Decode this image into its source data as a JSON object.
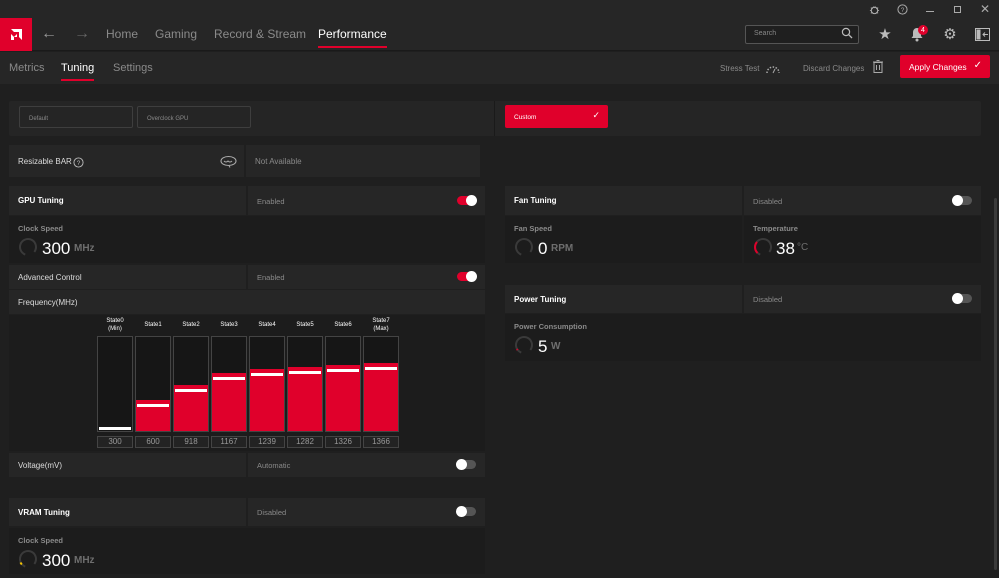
{
  "titlebar": {
    "icons": [
      "bug-icon",
      "help-icon",
      "minimize-icon",
      "maximize-icon",
      "close-icon"
    ]
  },
  "nav": {
    "tabs": [
      {
        "label": "Home"
      },
      {
        "label": "Gaming"
      },
      {
        "label": "Record & Stream"
      },
      {
        "label": "Performance",
        "active": true
      }
    ],
    "search_placeholder": "Search",
    "notification_count": "4"
  },
  "subnav": {
    "tabs": [
      {
        "label": "Metrics"
      },
      {
        "label": "Tuning",
        "active": true
      },
      {
        "label": "Settings"
      }
    ],
    "stress_test": "Stress Test",
    "discard": "Discard Changes",
    "apply": "Apply Changes"
  },
  "presets": {
    "default": "Default",
    "overclock": "Overclock GPU",
    "custom": "Custom"
  },
  "resizable_bar": {
    "label": "Resizable BAR",
    "status": "Not Available"
  },
  "gpu_tuning": {
    "label": "GPU Tuning",
    "status": "Enabled",
    "enabled": true,
    "clock_label": "Clock Speed",
    "clock_value": "300",
    "clock_unit": "MHz",
    "advanced_label": "Advanced Control",
    "advanced_status": "Enabled",
    "advanced_enabled": true,
    "frequency_label": "Frequency(MHz)",
    "states": [
      {
        "name": "State0",
        "sub": "(Min)",
        "value": 300
      },
      {
        "name": "State1",
        "sub": "",
        "value": 600
      },
      {
        "name": "State2",
        "sub": "",
        "value": 918
      },
      {
        "name": "State3",
        "sub": "",
        "value": 1167
      },
      {
        "name": "State4",
        "sub": "",
        "value": 1239
      },
      {
        "name": "State5",
        "sub": "",
        "value": 1282
      },
      {
        "name": "State6",
        "sub": "",
        "value": 1326
      },
      {
        "name": "State7",
        "sub": "(Max)",
        "value": 1366
      }
    ],
    "voltage_label": "Voltage(mV)",
    "voltage_status": "Automatic",
    "voltage_enabled": false
  },
  "vram_tuning": {
    "label": "VRAM Tuning",
    "status": "Disabled",
    "enabled": false,
    "clock_label": "Clock Speed",
    "clock_value": "300",
    "clock_unit": "MHz"
  },
  "fan_tuning": {
    "label": "Fan Tuning",
    "status": "Disabled",
    "enabled": false,
    "fan_speed_label": "Fan Speed",
    "fan_speed_value": "0",
    "fan_speed_unit": "RPM",
    "temp_label": "Temperature",
    "temp_value": "38",
    "temp_unit": "°C"
  },
  "power_tuning": {
    "label": "Power Tuning",
    "status": "Disabled",
    "enabled": false,
    "consumption_label": "Power Consumption",
    "consumption_value": "5",
    "consumption_unit": "W"
  },
  "colors": {
    "accent": "#e0002b",
    "vram_gauge": "#f5c400"
  }
}
